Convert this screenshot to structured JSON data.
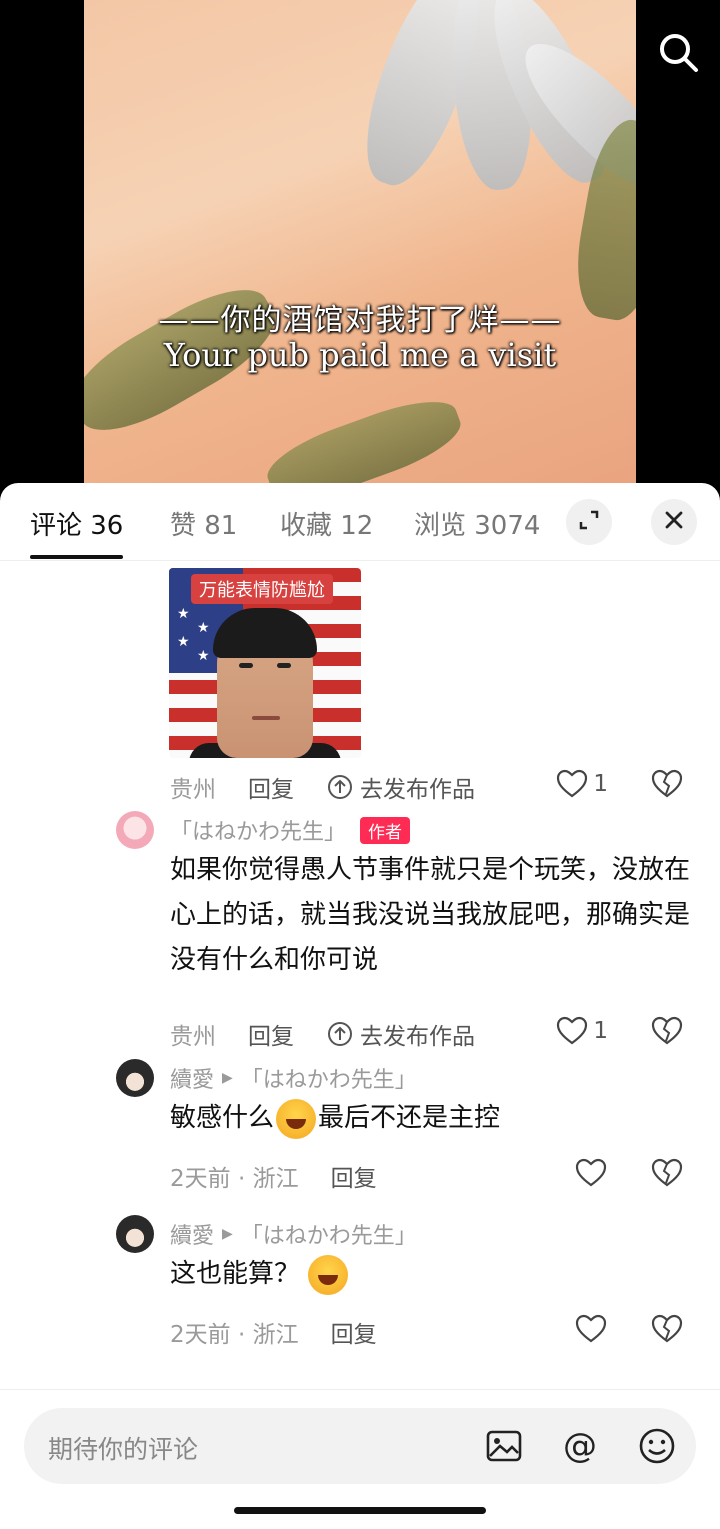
{
  "video": {
    "subtitle_cn": "——你的酒馆对我打了烊——",
    "subtitle_en": "Your pub paid me a visit"
  },
  "tabs": [
    {
      "label": "评论 36"
    },
    {
      "label": "赞 81"
    },
    {
      "label": "收藏 12"
    },
    {
      "label": "浏览 3074"
    }
  ],
  "sticker": {
    "caption": "万能表情防尴尬"
  },
  "comments": [
    {
      "location": "贵州",
      "reply_label": "回复",
      "publish_label": "去发布作品",
      "likes": "1"
    },
    {
      "user": "「はねかわ先生」",
      "badge": "作者",
      "text": "如果你觉得愚人节事件就只是个玩笑，没放在心上的话，就当我没说当我放屁吧，那确实是没有什么和你可说",
      "location": "贵州",
      "reply_label": "回复",
      "publish_label": "去发布作品",
      "likes": "1"
    },
    {
      "user": "續愛",
      "reply_to": "「はねかわ先生」",
      "text_before": "敏感什么",
      "text_after": "最后不还是主控",
      "time": "2天前 · 浙江",
      "reply_label": "回复"
    },
    {
      "user": "續愛",
      "reply_to": "「はねかわ先生」",
      "text": "这也能算？",
      "time": "2天前 · 浙江",
      "reply_label": "回复"
    }
  ],
  "input": {
    "placeholder": "期待你的评论"
  },
  "colors": {
    "accent": "#fe2c55",
    "text": "#111111",
    "muted": "#9a9a9a"
  }
}
